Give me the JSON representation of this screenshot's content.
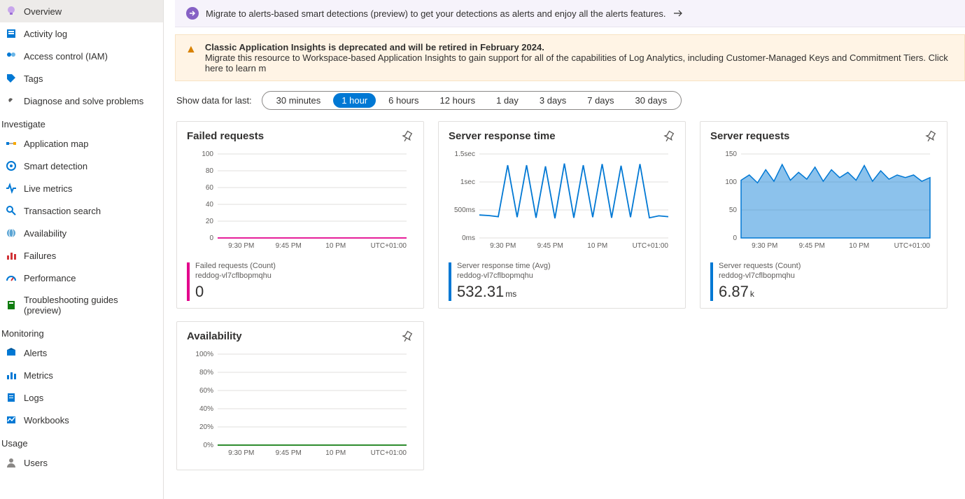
{
  "sidebar": {
    "items_top": [
      {
        "label": "Overview",
        "icon": "lightbulb"
      },
      {
        "label": "Activity log",
        "icon": "log"
      },
      {
        "label": "Access control (IAM)",
        "icon": "people"
      },
      {
        "label": "Tags",
        "icon": "tag"
      },
      {
        "label": "Diagnose and solve problems",
        "icon": "wrench"
      }
    ],
    "group_investigate": "Investigate",
    "items_investigate": [
      {
        "label": "Application map"
      },
      {
        "label": "Smart detection"
      },
      {
        "label": "Live metrics"
      },
      {
        "label": "Transaction search"
      },
      {
        "label": "Availability"
      },
      {
        "label": "Failures"
      },
      {
        "label": "Performance"
      },
      {
        "label": "Troubleshooting guides (preview)"
      }
    ],
    "group_monitoring": "Monitoring",
    "items_monitoring": [
      {
        "label": "Alerts"
      },
      {
        "label": "Metrics"
      },
      {
        "label": "Logs"
      },
      {
        "label": "Workbooks"
      }
    ],
    "group_usage": "Usage",
    "items_usage": [
      {
        "label": "Users"
      }
    ]
  },
  "banner": {
    "text": "Migrate to alerts-based smart detections (preview) to get your detections as alerts and enjoy all the alerts features."
  },
  "warn": {
    "title": "Classic Application Insights is deprecated and will be retired in February 2024.",
    "body": "Migrate this resource to Workspace-based Application Insights to gain support for all of the capabilities of Log Analytics, including Customer-Managed Keys and Commitment Tiers. Click here to learn m"
  },
  "timerange": {
    "label": "Show data for last:",
    "options": [
      "30 minutes",
      "1 hour",
      "6 hours",
      "12 hours",
      "1 day",
      "3 days",
      "7 days",
      "30 days"
    ],
    "selected": "1 hour"
  },
  "cards": {
    "failed": {
      "title": "Failed requests",
      "legend_label": "Failed requests (Count)",
      "legend_sub": "reddog-vl7cflbopmqhu",
      "value": "0",
      "unit": ""
    },
    "response": {
      "title": "Server response time",
      "legend_label": "Server response time (Avg)",
      "legend_sub": "reddog-vl7cflbopmqhu",
      "value": "532.31",
      "unit": "ms"
    },
    "requests": {
      "title": "Server requests",
      "legend_label": "Server requests (Count)",
      "legend_sub": "reddog-vl7cflbopmqhu",
      "value": "6.87",
      "unit": "k"
    },
    "availability": {
      "title": "Availability"
    }
  },
  "chart_data": [
    {
      "id": "failed_requests",
      "type": "line",
      "title": "Failed requests",
      "y_ticks": [
        "100",
        "80",
        "60",
        "40",
        "20",
        "0"
      ],
      "x_ticks": [
        "9:30 PM",
        "9:45 PM",
        "10 PM"
      ],
      "tz": "UTC+01:00",
      "ylim": [
        0,
        100
      ],
      "series": [
        {
          "name": "Failed requests (Count)",
          "color": "#e3008c",
          "values": [
            0,
            0,
            0,
            0,
            0,
            0,
            0,
            0,
            0,
            0,
            0,
            0
          ]
        }
      ]
    },
    {
      "id": "server_response_time",
      "type": "line",
      "title": "Server response time",
      "y_ticks": [
        "1.5sec",
        "1sec",
        "500ms",
        "0ms"
      ],
      "x_ticks": [
        "9:30 PM",
        "9:45 PM",
        "10 PM"
      ],
      "tz": "UTC+01:00",
      "ylim": [
        0,
        1500
      ],
      "series": [
        {
          "name": "Server response time (Avg)",
          "color": "#0078d4",
          "values": [
            410,
            400,
            380,
            1300,
            370,
            1300,
            360,
            1280,
            350,
            1330,
            360,
            1300,
            370,
            1320,
            360,
            1290,
            370,
            1320,
            360,
            395,
            380
          ]
        }
      ]
    },
    {
      "id": "server_requests",
      "type": "area",
      "title": "Server requests",
      "y_ticks": [
        "150",
        "100",
        "50",
        "0"
      ],
      "x_ticks": [
        "9:30 PM",
        "9:45 PM",
        "10 PM"
      ],
      "tz": "UTC+01:00",
      "ylim": [
        0,
        160
      ],
      "series": [
        {
          "name": "Server requests (Count)",
          "color": "#0078d4",
          "values": [
            110,
            120,
            105,
            130,
            108,
            140,
            110,
            125,
            112,
            135,
            108,
            130,
            115,
            125,
            110,
            138,
            108,
            128,
            112,
            120,
            115,
            120,
            108,
            115
          ]
        }
      ]
    },
    {
      "id": "availability",
      "type": "line",
      "title": "Availability",
      "y_ticks": [
        "100%",
        "80%",
        "60%",
        "40%",
        "20%",
        "0%"
      ],
      "x_ticks": [
        "9:30 PM",
        "9:45 PM",
        "10 PM"
      ],
      "tz": "UTC+01:00",
      "ylim": [
        0,
        100
      ],
      "series": [
        {
          "name": "Availability",
          "color": "#107c10",
          "values": [
            0,
            0,
            0,
            0,
            0,
            0,
            0,
            0,
            0,
            0,
            0,
            0
          ]
        }
      ]
    }
  ]
}
